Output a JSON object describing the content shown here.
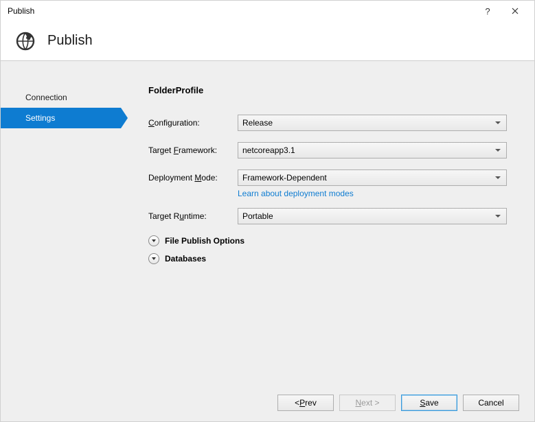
{
  "window": {
    "title": "Publish"
  },
  "banner": {
    "title": "Publish"
  },
  "sidebar": {
    "items": [
      {
        "label": "Connection",
        "active": false
      },
      {
        "label": "Settings",
        "active": true
      }
    ]
  },
  "main": {
    "profile_name": "FolderProfile",
    "fields": {
      "configuration": {
        "label_pre": "",
        "label_mnemonic": "C",
        "label_post": "onfiguration:",
        "value": "Release"
      },
      "target_framework": {
        "label_pre": "Target ",
        "label_mnemonic": "F",
        "label_post": "ramework:",
        "value": "netcoreapp3.1"
      },
      "deployment_mode": {
        "label_pre": "Deployment ",
        "label_mnemonic": "M",
        "label_post": "ode:",
        "value": "Framework-Dependent",
        "link": "Learn about deployment modes"
      },
      "target_runtime": {
        "label_pre": "Target R",
        "label_mnemonic": "u",
        "label_post": "ntime:",
        "value": "Portable"
      }
    },
    "expanders": [
      {
        "label": "File Publish Options"
      },
      {
        "label": "Databases"
      }
    ]
  },
  "footer": {
    "prev": {
      "arrow": "< ",
      "mnemonic": "P",
      "rest": "rev"
    },
    "next": {
      "mnemonic": "N",
      "rest": "ext >"
    },
    "save": {
      "mnemonic": "S",
      "rest": "ave"
    },
    "cancel": {
      "label": "Cancel"
    }
  }
}
